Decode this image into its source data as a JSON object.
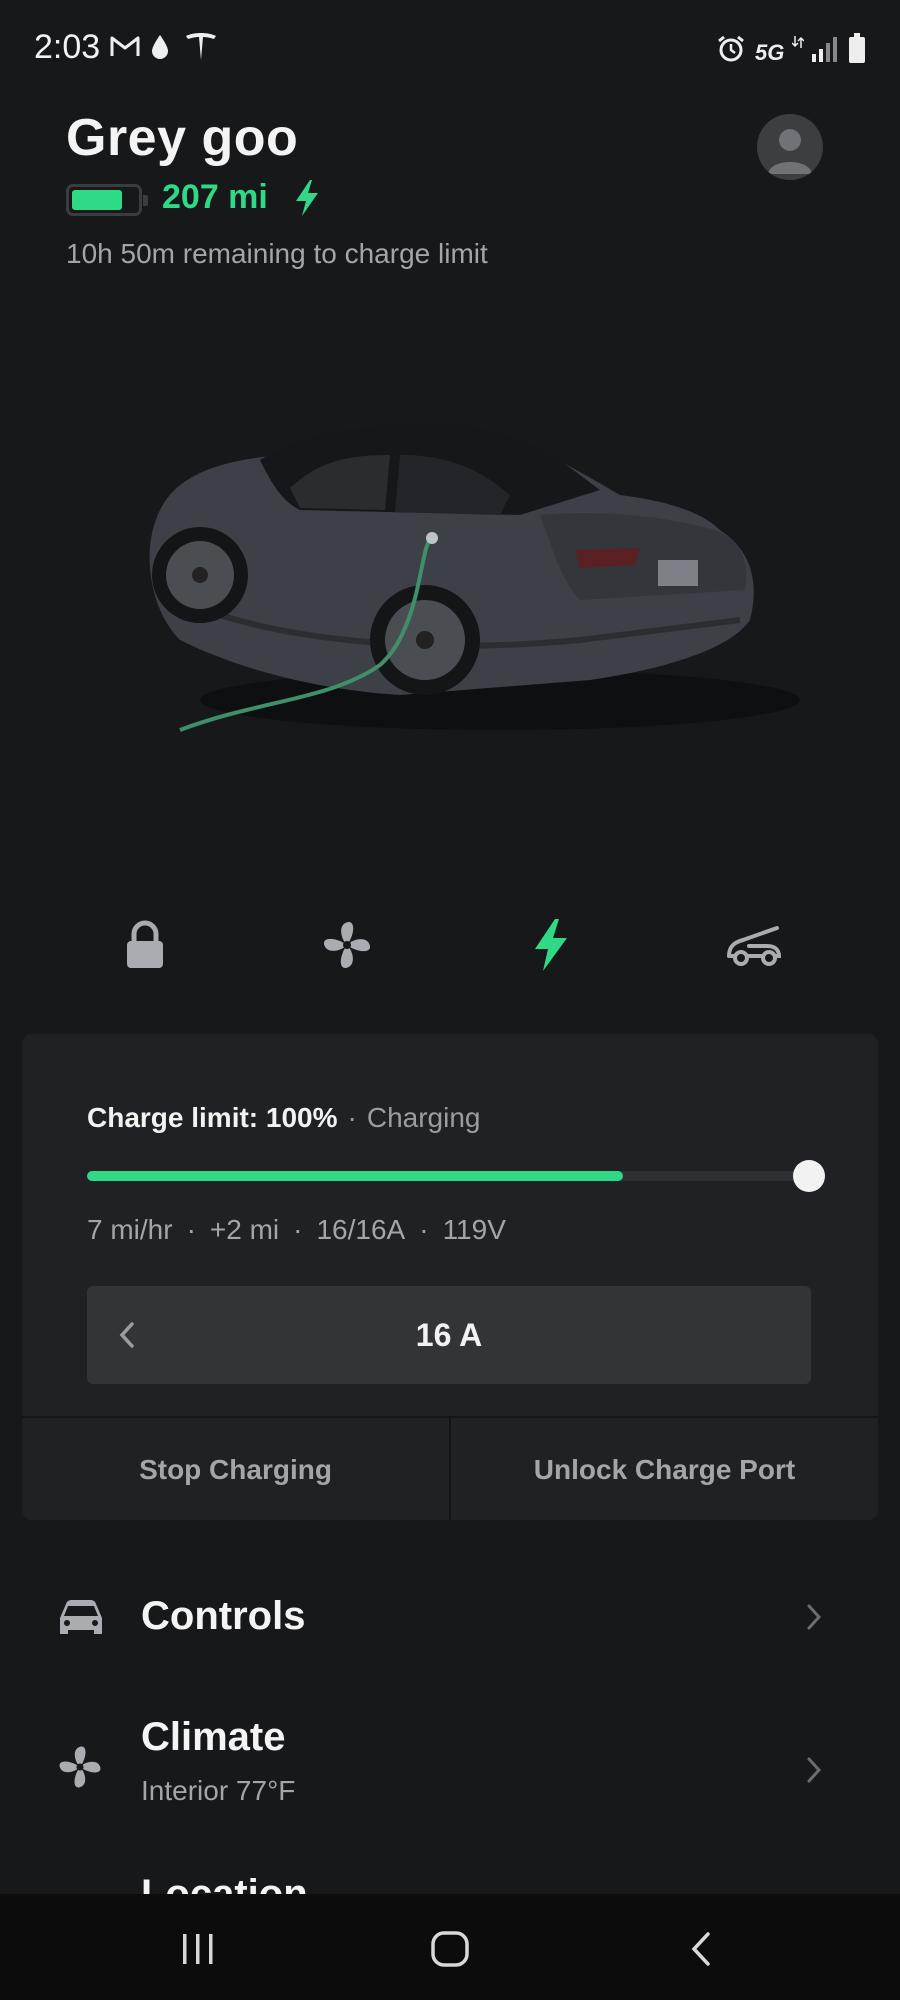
{
  "status_bar": {
    "time": "2:03",
    "left_icons": [
      "gmail-icon",
      "water-drop-icon",
      "tesla-logo-icon"
    ],
    "right_icons": [
      "alarm-icon",
      "5g-icon",
      "signal-icon",
      "battery-icon"
    ],
    "network": "5G"
  },
  "header": {
    "car_name": "Grey goo",
    "range": "207 mi",
    "charge_status": "10h 50m remaining to charge limit",
    "battery_level": 0.7
  },
  "quick_actions": [
    {
      "name": "lock",
      "icon": "lock-icon"
    },
    {
      "name": "climate",
      "icon": "fan-icon"
    },
    {
      "name": "charging",
      "icon": "bolt-icon",
      "active": true
    },
    {
      "name": "frunk",
      "icon": "frunk-icon"
    }
  ],
  "charge_card": {
    "limit_label": "Charge limit: 100%",
    "dot": "·",
    "state": "Charging",
    "current_level_percent": 73,
    "limit_percent": 100,
    "stats": [
      "7 mi/hr",
      "+2 mi",
      "16/16A",
      "119V"
    ],
    "amperage": "16 A",
    "stop_button": "Stop Charging",
    "unlock_button": "Unlock Charge Port"
  },
  "menu": [
    {
      "title": "Controls",
      "subtitle": "",
      "icon": "car-icon"
    },
    {
      "title": "Climate",
      "subtitle": "Interior 77°F",
      "icon": "fan-icon"
    },
    {
      "title": "Location",
      "subtitle": "",
      "icon": "location-icon"
    }
  ],
  "colors": {
    "accent_green": "#2fd985",
    "background": "#17181a",
    "card": "#202124"
  }
}
